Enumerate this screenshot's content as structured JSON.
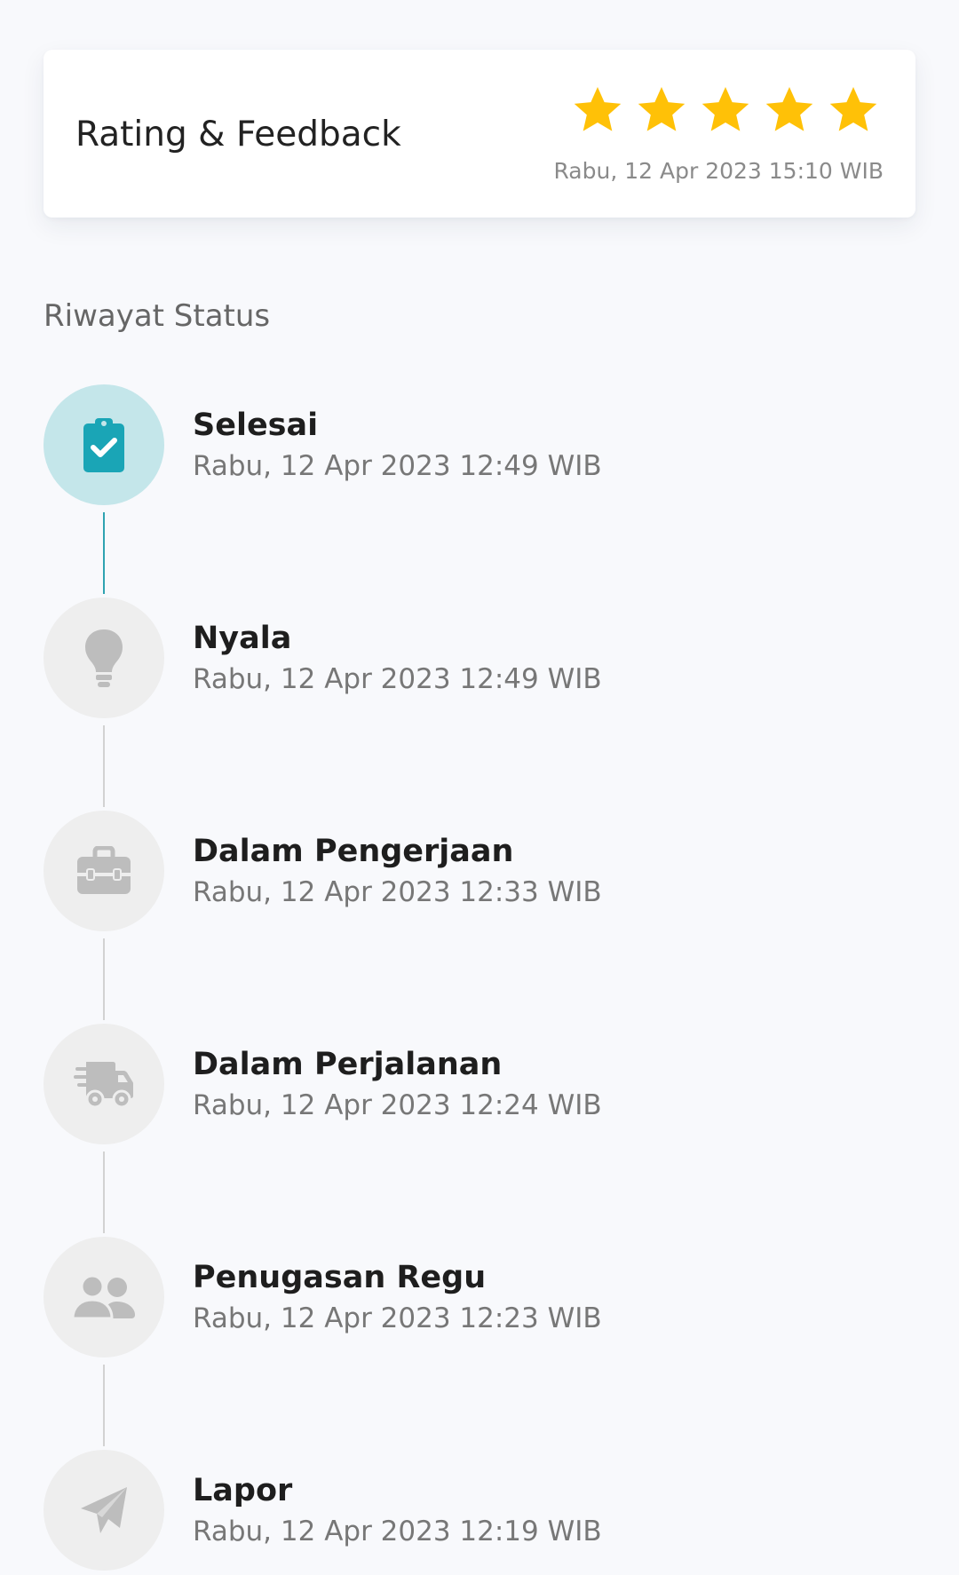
{
  "rating": {
    "title": "Rating & Feedback",
    "stars": 5,
    "max_stars": 5,
    "timestamp": "Rabu, 12 Apr 2023 15:10 WIB",
    "star_color": "#FFC107"
  },
  "history": {
    "title": "Riwayat Status",
    "items": [
      {
        "status": "Selesai",
        "time": "Rabu, 12 Apr 2023 12:49 WIB",
        "icon": "clipboard-check-icon",
        "active": true
      },
      {
        "status": "Nyala",
        "time": "Rabu, 12 Apr 2023 12:49 WIB",
        "icon": "lightbulb-icon",
        "active": false
      },
      {
        "status": "Dalam Pengerjaan",
        "time": "Rabu, 12 Apr 2023 12:33 WIB",
        "icon": "toolbox-icon",
        "active": false
      },
      {
        "status": "Dalam Perjalanan",
        "time": "Rabu, 12 Apr 2023 12:24 WIB",
        "icon": "truck-icon",
        "active": false
      },
      {
        "status": "Penugasan Regu",
        "time": "Rabu, 12 Apr 2023 12:23 WIB",
        "icon": "users-icon",
        "active": false
      },
      {
        "status": "Lapor",
        "time": "Rabu, 12 Apr 2023 12:19 WIB",
        "icon": "paper-plane-icon",
        "active": false
      }
    ]
  },
  "colors": {
    "accent": "#2FA3B1",
    "accent_light": "#C4E6EA",
    "inactive_icon": "#BDBDBD",
    "inactive_circle": "#EEEEEE"
  }
}
